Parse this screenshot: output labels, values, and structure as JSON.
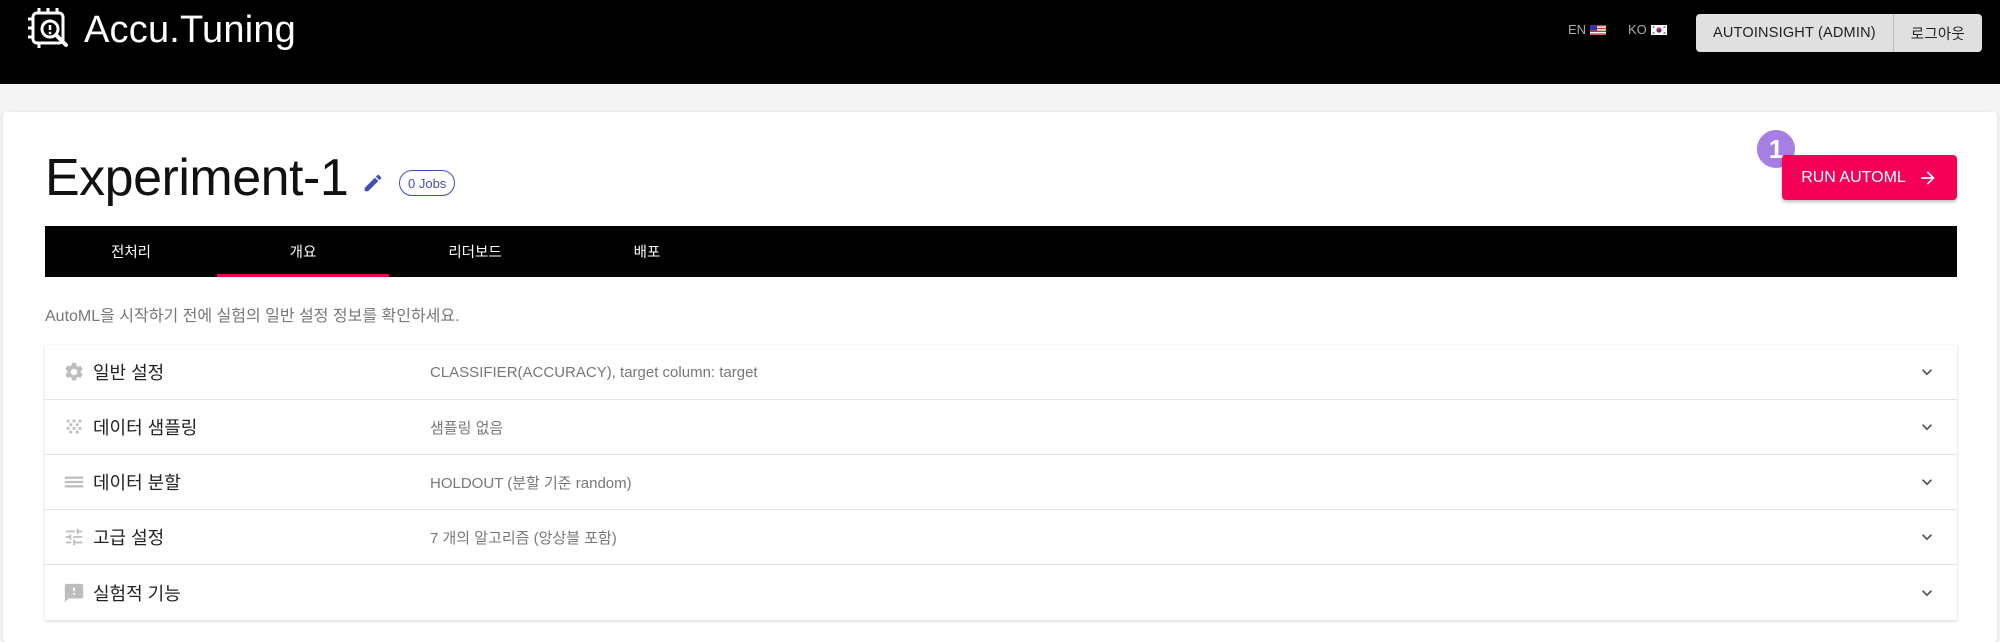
{
  "app": {
    "name": "Accu.Tuning"
  },
  "header": {
    "lang_en": "EN",
    "lang_ko": "KO",
    "user_button": "AUTOINSIGHT (ADMIN)",
    "logout_button": "로그아웃"
  },
  "experiment": {
    "title": "Experiment-1",
    "jobs_chip": "0 Jobs",
    "run_button": "RUN AUTOML",
    "step_badge": "1"
  },
  "tabs": [
    {
      "label": "전처리",
      "active": false
    },
    {
      "label": "개요",
      "active": true
    },
    {
      "label": "리더보드",
      "active": false
    },
    {
      "label": "배포",
      "active": false
    }
  ],
  "description": "AutoML을 시작하기 전에 실험의 일반 설정 정보를 확인하세요.",
  "sections": [
    {
      "icon": "gear-icon",
      "label": "일반 설정",
      "summary": "CLASSIFIER(ACCURACY), target column: target"
    },
    {
      "icon": "sampling-icon",
      "label": "데이터 샘플링",
      "summary": "샘플링 없음"
    },
    {
      "icon": "split-icon",
      "label": "데이터 분할",
      "summary": "HOLDOUT (분할 기준 random)"
    },
    {
      "icon": "tune-icon",
      "label": "고급 설정",
      "summary": "7 개의 알고리즘 (앙상블 포함)"
    },
    {
      "icon": "feedback-icon",
      "label": "실험적 기능",
      "summary": ""
    }
  ],
  "colors": {
    "accent": "#f50057",
    "primary": "#3f51b5",
    "badge": "#a77de6",
    "topbar": "#000000"
  }
}
